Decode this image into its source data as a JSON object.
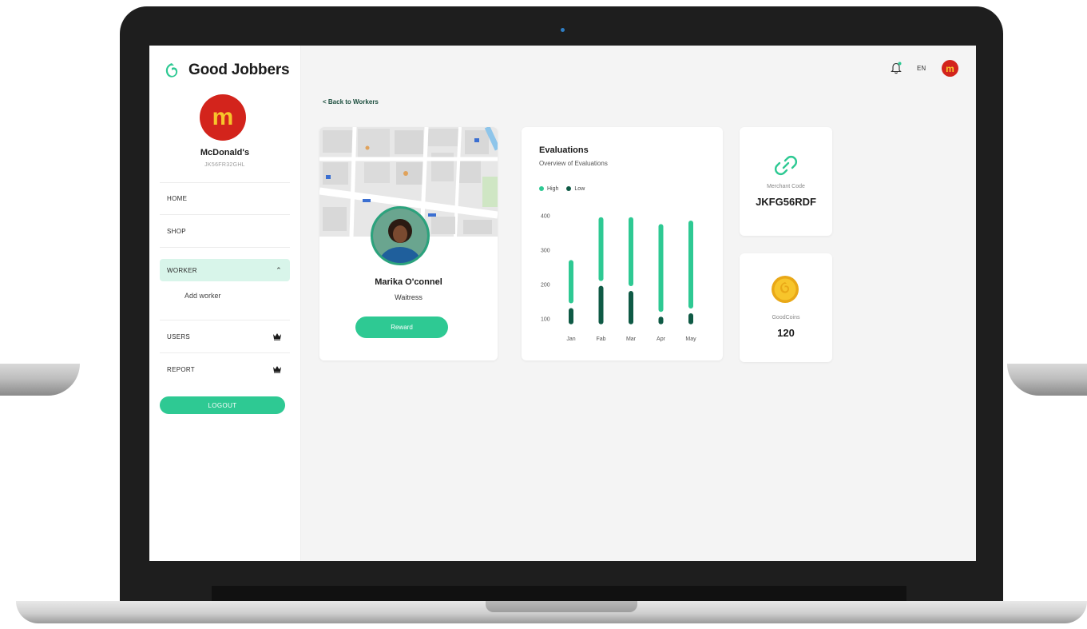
{
  "app": {
    "brand_name": "Good Jobbers",
    "brand_color": "#2ec993"
  },
  "header": {
    "language": "EN",
    "avatar_letter": "m"
  },
  "sidebar": {
    "merchant_logo_letter": "m",
    "merchant_name": "McDonald's",
    "merchant_id": "JK56FR32GHL",
    "items": [
      {
        "label": "HOME"
      },
      {
        "label": "SHOP"
      },
      {
        "label": "WORKER",
        "expanded": true,
        "children": [
          {
            "label": "Add worker"
          }
        ]
      },
      {
        "label": "USERS",
        "icon": "crown-icon"
      },
      {
        "label": "REPORT",
        "icon": "crown-icon"
      }
    ],
    "logout_label": "LOGOUT"
  },
  "main": {
    "back_link": "< Back to Workers",
    "profile": {
      "name": "Marika O'connel",
      "role": "Waitress",
      "reward_label": "Reward"
    },
    "merchant_code": {
      "label": "Merchant Code",
      "value": "JKFG56RDF"
    },
    "goodcoins": {
      "label": "GoodCoins",
      "value": "120"
    }
  },
  "chart_data": {
    "type": "bar",
    "title": "Evaluations",
    "subtitle": "Overview of Evaluations",
    "categories": [
      "Jan",
      "Fab",
      "Mar",
      "Apr",
      "May"
    ],
    "series": [
      {
        "name": "High",
        "color": "#2ec993",
        "values": [
          270,
          395,
          395,
          375,
          385
        ]
      },
      {
        "name": "Low",
        "color": "#0f5a45",
        "values": [
          130,
          195,
          180,
          105,
          115
        ]
      }
    ],
    "yticks": [
      100,
      200,
      300,
      400
    ],
    "ylim": [
      80,
      420
    ],
    "grid": false,
    "legend": "top-left"
  }
}
